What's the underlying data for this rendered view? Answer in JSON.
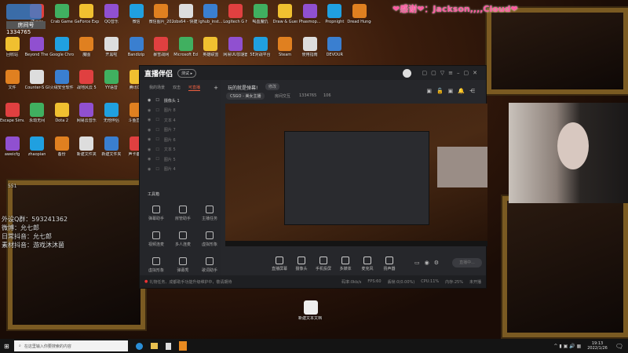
{
  "desktop": {
    "icons": [
      [
        "",
        "iTunes",
        "Crab Game",
        "GeForce Experience",
        "QQ音乐",
        "微信",
        "微信图片_2021111...",
        "obs64 - 快捷方式",
        "lghub_inst...",
        "Logitech G HUB",
        "喝血魔仇",
        "Draw & Guess",
        "Phasmop...",
        "Propnight",
        "Dread Hunger"
      ],
      [
        "回收站",
        "Beyond The Wire Soun...",
        "Google Chrome",
        "魔图",
        "开黑啦",
        "Bandizip",
        "暴雪战网",
        "Microsoft Edge",
        "英雄联盟",
        "网易UU加速器",
        "5E对战平台",
        "Steam",
        "使用指南",
        "DEVOUR"
      ],
      [
        "文件",
        "Counter-S Global Off...",
        "火绒安全软件",
        "战地风云 5",
        "YY语音",
        "腾讯QQ"
      ],
      [
        "Escape Simulator",
        "永劫无间",
        "Dota 2",
        "网易云音乐",
        "无他伴侣",
        "斗鱼直播"
      ],
      [
        "aweicfg",
        "zhaopian",
        "备份",
        "新建文件夹",
        "新建文件夹",
        "声卡备份"
      ]
    ],
    "logo_room_label": "房间号",
    "logo_room_number": "1334765",
    "stray_text": "551",
    "center_icon": "新建文本文档 (3)",
    "info_lines": [
      "外设Q群：593241362",
      "微博：允七郎",
      "日常抖音：允七郎",
      "素材抖音：游戏沐沐菌"
    ],
    "overlay": "❤感谢❤：Jackson,,,,Cloud❤"
  },
  "app": {
    "title": "直播伴侣",
    "title_badge": "测试 ▸",
    "scene_tabs": [
      "我的场景",
      "双击",
      "可直播"
    ],
    "sources": [
      "摄像头 1",
      "图片 8",
      "文本 4",
      "图片 7",
      "图片 6",
      "文本 5",
      "图片 5",
      "图片 4"
    ],
    "toolbox_label": "工具箱",
    "tools": [
      "弹幕助手",
      "房管助手",
      "主播任务",
      "视频连麦",
      "多人连麦",
      "虚拟形象",
      "虚拟形象",
      "弹幕秀",
      "歌词助手"
    ],
    "stream_title": "玩的就是弹幕!",
    "edit_label": "修改",
    "category": "CSGO - 美女主播",
    "room_interact": "房间交互",
    "room_id": "1334765",
    "popularity": "106",
    "controls": [
      "直播屏幕",
      "摄像头",
      "手机投屏",
      "多媒体",
      "麦克风",
      "扬声器"
    ],
    "start_button": "直播中...",
    "status_notice": "礼物任务、成都助手功能升级维护中，敬请期待",
    "stats": [
      "码率:0kb/s",
      "FPS:60",
      "丢帧:0(0.00%)",
      "CPU:11%",
      "内存:25%",
      "未开播"
    ]
  },
  "taskbar": {
    "search_placeholder": "在这里输入你要搜索的内容",
    "time": "19:13",
    "date": "2022/1/26"
  }
}
